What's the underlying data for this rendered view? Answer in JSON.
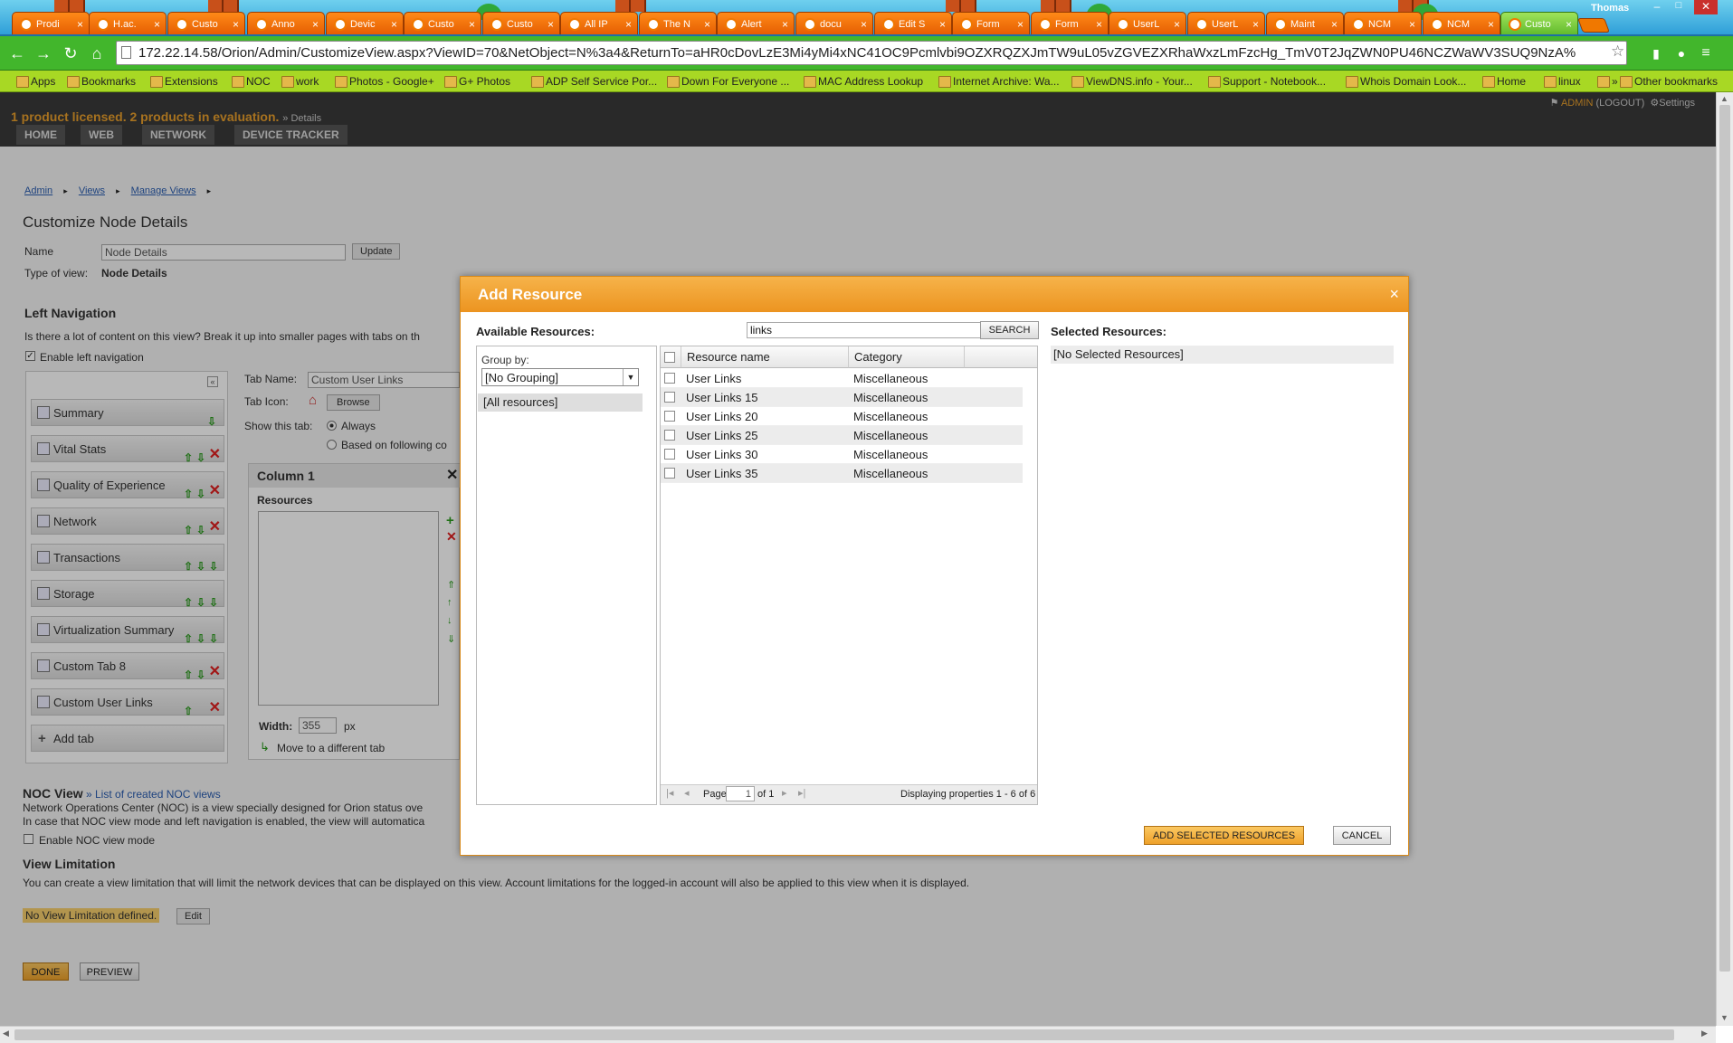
{
  "browser": {
    "tabs": [
      {
        "label": "Prodi"
      },
      {
        "label": "H.ac."
      },
      {
        "label": "Custo"
      },
      {
        "label": "Anno"
      },
      {
        "label": "Devic"
      },
      {
        "label": "Custo"
      },
      {
        "label": "Custo"
      },
      {
        "label": "All IP"
      },
      {
        "label": "The N"
      },
      {
        "label": "Alert"
      },
      {
        "label": "docu"
      },
      {
        "label": "Edit S"
      },
      {
        "label": "Form"
      },
      {
        "label": "Form"
      },
      {
        "label": "UserL"
      },
      {
        "label": "UserL"
      },
      {
        "label": "Maint"
      },
      {
        "label": "NCM"
      },
      {
        "label": "NCM"
      },
      {
        "label": "Custo"
      }
    ],
    "profile_name": "Thomas",
    "url": "172.22.14.58/Orion/Admin/CustomizeView.aspx?ViewID=70&NetObject=N%3a4&ReturnTo=aHR0cDovLzE3Mi4yMi4xNC41OC9Pcmlvbi9OZXRQZXJmTW9uL05vZGVEZXRhaWxzLmFzcHg_TmV0T2JqZWN0PU46NCZWaWV3SUQ9NzA%",
    "bookmarks": [
      {
        "label": "Apps"
      },
      {
        "label": "Bookmarks"
      },
      {
        "label": "Extensions"
      },
      {
        "label": "NOC"
      },
      {
        "label": "work"
      },
      {
        "label": "Photos - Google+"
      },
      {
        "label": "G+ Photos"
      },
      {
        "label": "ADP Self Service Por..."
      },
      {
        "label": "Down For Everyone ..."
      },
      {
        "label": "MAC Address Lookup"
      },
      {
        "label": "Internet Archive: Wa..."
      },
      {
        "label": "ViewDNS.info - Your..."
      },
      {
        "label": "Support - Notebook..."
      },
      {
        "label": "Whois Domain Look..."
      },
      {
        "label": "Home"
      },
      {
        "label": "linux"
      },
      {
        "label": "»"
      },
      {
        "label": "Other bookmarks"
      }
    ]
  },
  "app": {
    "license": "1 product licensed.  2 products in evaluation.",
    "details_link": "» Details",
    "menu": [
      "HOME",
      "WEB",
      "NETWORK",
      "DEVICE TRACKER"
    ],
    "admin": "ADMIN",
    "logout": "(LOGOUT)",
    "settings": "Settings"
  },
  "page": {
    "breadcrumb": [
      "Admin",
      "Views",
      "Manage Views"
    ],
    "title": "Customize Node Details",
    "name_label": "Name",
    "name_value": "Node Details",
    "update": "Update",
    "type_label": "Type of view:",
    "type_value": "Node Details",
    "left_nav_title": "Left Navigation",
    "left_nav_desc": "Is there a lot of content on this view? Break it up into smaller pages with tabs on th",
    "enable_left_nav": "Enable left navigation",
    "nav_items": [
      "Summary",
      "Vital Stats",
      "Quality of Experience",
      "Network",
      "Transactions",
      "Storage",
      "Virtualization Summary",
      "Custom Tab 8",
      "Custom User Links"
    ],
    "add_tab": "Add tab",
    "tab_name_label": "Tab Name:",
    "tab_name_value": "Custom User Links",
    "tab_icon_label": "Tab Icon:",
    "browse": "Browse",
    "show_tab_label": "Show this tab:",
    "always": "Always",
    "based_on": "Based on following co",
    "column_title": "Column 1",
    "resources_label": "Resources",
    "width_label": "Width:",
    "width_value": "355",
    "px": "px",
    "move_tab": "Move to a different tab",
    "noc_title": "NOC View",
    "noc_link": "» List of created NOC views",
    "noc_desc1": "Network Operations Center (NOC) is a view specially designed for Orion status ove",
    "noc_desc2": "In case that NOC view mode and left navigation is enabled, the view will automatica",
    "enable_noc": "Enable NOC view mode",
    "limit_title": "View Limitation",
    "limit_desc": "You can create a view limitation that will limit the network devices that can be displayed on this view. Account limitations for the logged-in account will also be applied to this view when it is displayed.",
    "no_limit": "No View Limitation defined.",
    "edit": "Edit",
    "done": "DONE",
    "preview": "PREVIEW"
  },
  "dialog": {
    "title": "Add Resource",
    "close": "×",
    "available": "Available Resources:",
    "search_value": "links",
    "search_btn": "SEARCH",
    "selected": "Selected Resources:",
    "no_selected": "[No Selected Resources]",
    "group_by_label": "Group by:",
    "group_by_value": "[No Grouping]",
    "all_resources": "[All resources]",
    "col_name": "Resource name",
    "col_category": "Category",
    "rows": [
      {
        "name": "User Links",
        "category": "Miscellaneous"
      },
      {
        "name": "User Links 15",
        "category": "Miscellaneous"
      },
      {
        "name": "User Links 20",
        "category": "Miscellaneous"
      },
      {
        "name": "User Links 25",
        "category": "Miscellaneous"
      },
      {
        "name": "User Links 30",
        "category": "Miscellaneous"
      },
      {
        "name": "User Links 35",
        "category": "Miscellaneous"
      }
    ],
    "page_label": "Page",
    "page_value": "1",
    "of_label": "of 1",
    "displaying": "Displaying properties 1 - 6 of 6",
    "add_selected": "ADD SELECTED RESOURCES",
    "cancel": "CANCEL"
  },
  "colors": {
    "accent": "#ec9420",
    "header": "#3a3a3a",
    "link": "#2a5db0"
  }
}
